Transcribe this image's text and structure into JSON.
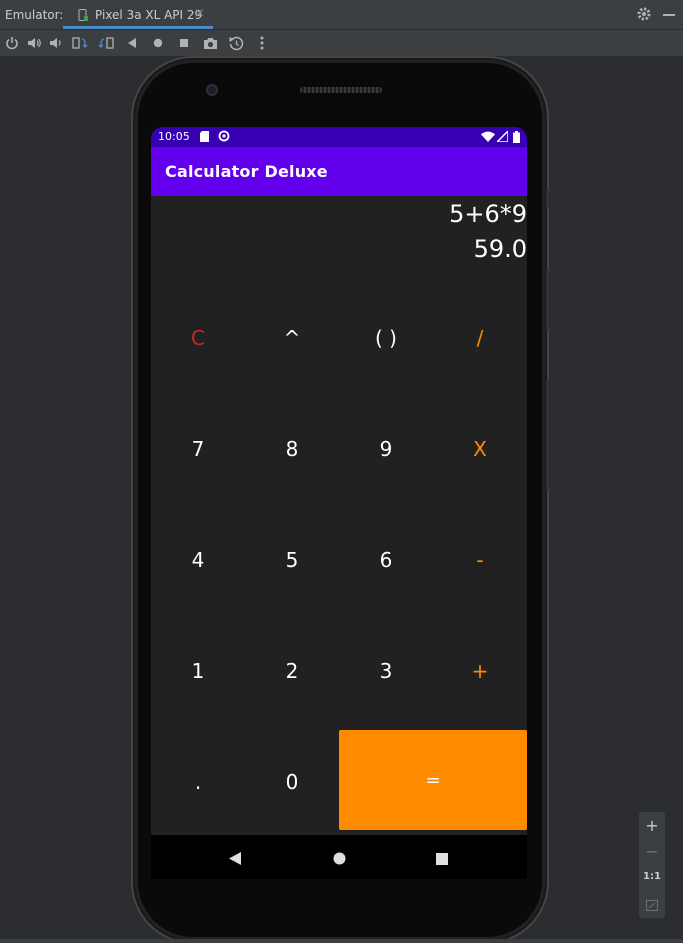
{
  "emulator": {
    "label": "Emulator:",
    "tab_title": "Pixel 3a XL API 29",
    "tab_close": "×",
    "toolbar_icons": [
      "power-icon",
      "volume-up-icon",
      "volume-down-icon",
      "rotate-left-icon",
      "rotate-right-icon",
      "back-icon",
      "home-icon",
      "overview-icon",
      "screenshot-icon",
      "snapshot-icon",
      "more-icon"
    ],
    "zoom": {
      "plus": "+",
      "minus": "−",
      "one_to_one": "1:1"
    }
  },
  "device": {
    "status_time": "10:05",
    "status_icons": [
      "sd-card-icon",
      "sync-icon",
      "wifi-icon",
      "signal-icon",
      "battery-icon"
    ]
  },
  "app": {
    "title": "Calculator Deluxe",
    "expression": "5+6*9",
    "result": "59.0",
    "keys": {
      "clear": "C",
      "power": "^",
      "parens": "( )",
      "divide": "/",
      "seven": "7",
      "eight": "8",
      "nine": "9",
      "multiply": "X",
      "four": "4",
      "five": "5",
      "six": "6",
      "minus": "-",
      "one": "1",
      "two": "2",
      "three": "3",
      "plus": "+",
      "dot": ".",
      "zero": "0",
      "equals": "="
    }
  },
  "colors": {
    "status_bar": "#3700b3",
    "app_bar": "#6200ee",
    "screen_bg": "#212121",
    "accent_orange": "#ff8c00",
    "clear_red": "#c62828"
  }
}
